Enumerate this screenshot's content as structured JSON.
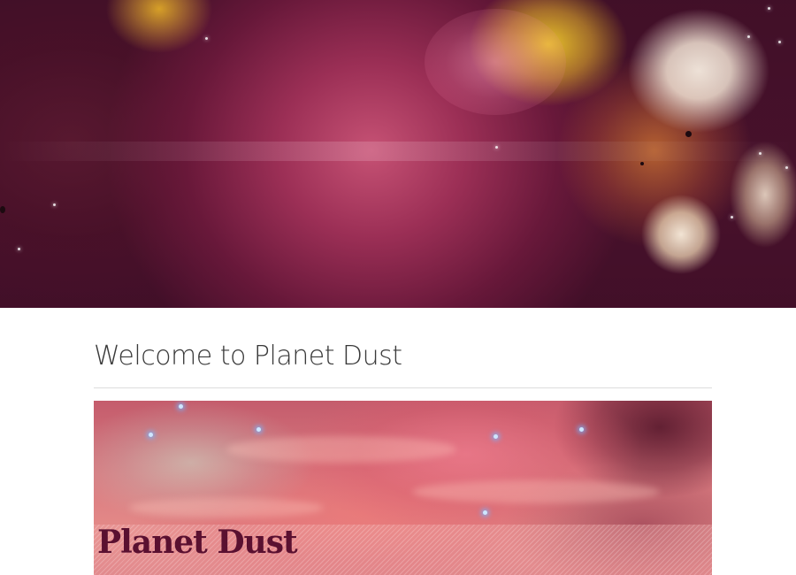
{
  "page": {
    "welcome_heading": "Welcome to Planet Dust"
  },
  "hero": {
    "image_name": "cosmic-nebula-hero-image"
  },
  "feature": {
    "image_name": "orion-nebula-feature-image",
    "logo_text": "Planet Dust"
  },
  "colors": {
    "heading_text": "#3a3a3a",
    "divider": "#dcdcdc",
    "logo_text": "#5a1030"
  }
}
